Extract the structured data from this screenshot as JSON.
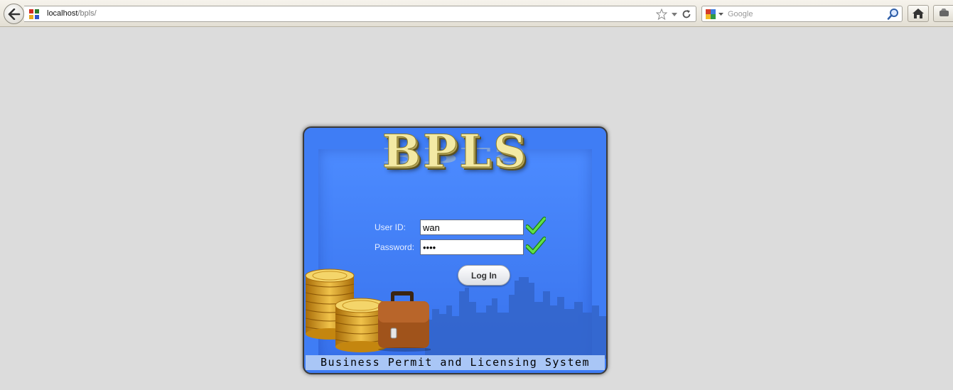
{
  "browser": {
    "url_host": "localhost",
    "url_path": "/bpls/",
    "search_engine": "google-icon",
    "search_placeholder": "Google"
  },
  "app": {
    "logo_text": "BPLS",
    "user_id_label": "User ID:",
    "user_id_value": "wan",
    "password_label": "Password:",
    "password_value": "wwww",
    "login_button": "Log In",
    "footer": "Business Permit and Licensing System"
  },
  "colors": {
    "panel_bg": "#3f7df5",
    "logo_gold": "#f3e9a4",
    "footer_band": "#a9c6f6",
    "check_green": "#3bbf2e"
  }
}
